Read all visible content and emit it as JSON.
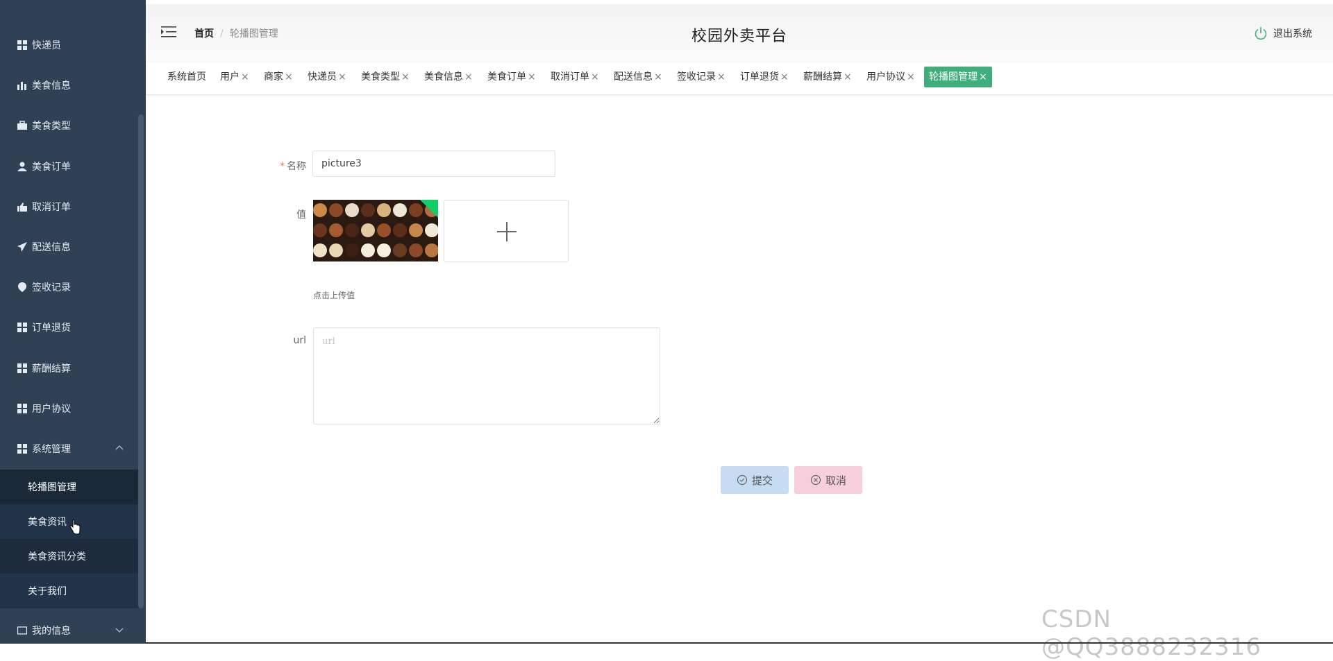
{
  "sidebar": {
    "items": [
      {
        "label": "快递员",
        "icon": "grid-icon"
      },
      {
        "label": "美食信息",
        "icon": "bar-chart-icon"
      },
      {
        "label": "美食类型",
        "icon": "briefcase-icon"
      },
      {
        "label": "美食订单",
        "icon": "user-icon"
      },
      {
        "label": "取消订单",
        "icon": "thumb-icon"
      },
      {
        "label": "配送信息",
        "icon": "paper-plane-icon"
      },
      {
        "label": "签收记录",
        "icon": "location-pin-icon"
      },
      {
        "label": "订单退货",
        "icon": "grid-icon"
      },
      {
        "label": "薪酬结算",
        "icon": "grid-icon"
      },
      {
        "label": "用户协议",
        "icon": "grid-icon"
      },
      {
        "label": "系统管理",
        "icon": "grid-icon"
      }
    ],
    "submenu": [
      {
        "label": "轮播图管理"
      },
      {
        "label": "美食资讯"
      },
      {
        "label": "美食资讯分类"
      },
      {
        "label": "关于我们"
      }
    ],
    "bottom_item": {
      "label": "我的信息"
    }
  },
  "header": {
    "breadcrumb_home": "首页",
    "breadcrumb_sep": "/",
    "breadcrumb_current": "轮播图管理",
    "title": "校园外卖平台",
    "logout_label": "退出系统"
  },
  "tabs": [
    {
      "label": "系统首页",
      "closable": false
    },
    {
      "label": "用户",
      "closable": true
    },
    {
      "label": "商家",
      "closable": true
    },
    {
      "label": "快递员",
      "closable": true
    },
    {
      "label": "美食类型",
      "closable": true
    },
    {
      "label": "美食信息",
      "closable": true
    },
    {
      "label": "美食订单",
      "closable": true
    },
    {
      "label": "取消订单",
      "closable": true
    },
    {
      "label": "配送信息",
      "closable": true
    },
    {
      "label": "签收记录",
      "closable": true
    },
    {
      "label": "订单退货",
      "closable": true
    },
    {
      "label": "薪酬结算",
      "closable": true
    },
    {
      "label": "用户协议",
      "closable": true
    },
    {
      "label": "轮播图管理",
      "closable": true,
      "active": true
    }
  ],
  "tab_close_glyph": "×",
  "form": {
    "name_label": "名称",
    "name_required_mark": "*",
    "name_value": "picture3",
    "value_label": "值",
    "upload_hint": "点击上传值",
    "url_label": "url",
    "url_placeholder": "url",
    "submit_label": "提交",
    "cancel_label": "取消"
  },
  "watermark": "CSDN @QQ3888232316",
  "colors": {
    "sidebar_bg": "#304156",
    "active_tab": "#3fae7c",
    "submit_bg": "#c6dcf2",
    "cancel_bg": "#f7cfdc"
  }
}
